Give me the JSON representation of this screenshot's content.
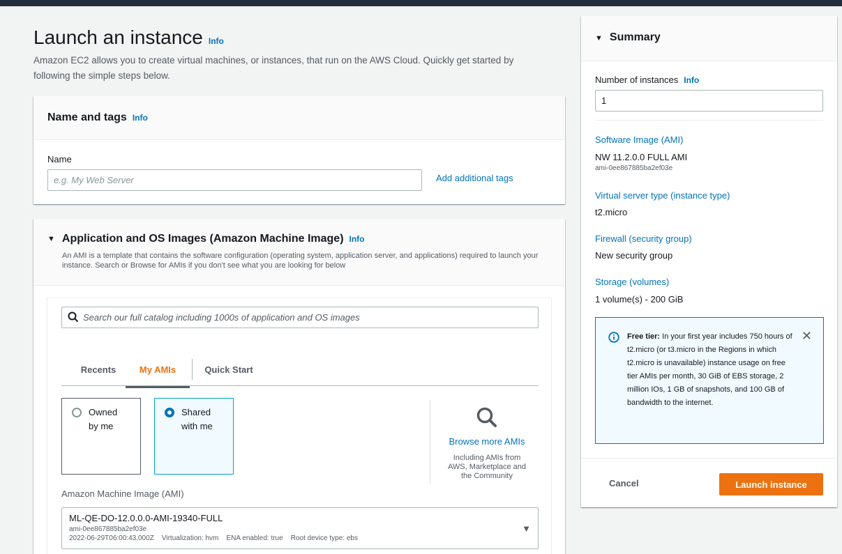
{
  "page": {
    "title": "Launch an instance",
    "info": "Info",
    "description": "Amazon EC2 allows you to create virtual machines, or instances, that run on the AWS Cloud. Quickly get started by following the simple steps below."
  },
  "name_tags": {
    "heading": "Name and tags",
    "info": "Info",
    "name_label": "Name",
    "name_placeholder": "e.g. My Web Server",
    "name_value": "",
    "add_tags_label": "Add additional tags"
  },
  "ami_section": {
    "heading": "Application and OS Images (Amazon Machine Image)",
    "info": "Info",
    "description": "An AMI is a template that contains the software configuration (operating system, application server, and applications) required to launch your instance. Search or Browse for AMIs if you don't see what you are looking for below",
    "search_placeholder": "Search our full catalog including 1000s of application and OS images",
    "tabs": [
      "Recents",
      "My AMIs",
      "Quick Start"
    ],
    "active_tab": "My AMIs",
    "owned_line1": "Owned",
    "owned_line2": "by me",
    "shared_line1": "Shared",
    "shared_line2": "with me",
    "selected_source": "Shared with me",
    "browse_label": "Browse more AMIs",
    "browse_sub_1": "Including AMIs from",
    "browse_sub_2": "AWS, Marketplace and",
    "browse_sub_3": "the Community",
    "ami_label": "Amazon Machine Image (AMI)",
    "selected_ami": {
      "name": "ML-QE-DO-12.0.0.0-AMI-19340-FULL",
      "id": "ami-0ee867885ba2ef03e",
      "meta": "2022-06-29T06:00:43.000Z    Virtualization: hvm    ENA enabled: true    Root device type: ebs"
    }
  },
  "summary": {
    "heading": "Summary",
    "instances_label": "Number of instances",
    "info": "Info",
    "instances_value": "1",
    "software_image_label": "Software Image (AMI)",
    "software_image_value": "NW 11.2.0.0 FULL AMI",
    "software_image_id": "ami-0ee867885ba2ef03e",
    "instance_type_label": "Virtual server type (instance type)",
    "instance_type_value": "t2.micro",
    "firewall_label": "Firewall (security group)",
    "firewall_value": "New security group",
    "storage_label": "Storage (volumes)",
    "storage_value": "1 volume(s) - 200 GiB",
    "free_tier_title": "Free tier:",
    "free_tier_text": "In your first year includes 750 hours of t2.micro (or t3.micro in the Regions in which t2.micro is unavailable) instance usage on free tier AMIs per month, 30 GiB of EBS storage, 2 million IOs, 1 GB of snapshots, and 100 GB of bandwidth to the internet.",
    "cancel_label": "Cancel",
    "launch_label": "Launch instance"
  },
  "colors": {
    "accent_orange": "#ec7211",
    "link_blue": "#0073bb",
    "selected_border": "#00a1c9",
    "topbar": "#232f3e"
  },
  "icons": [
    "search-icon",
    "magnifier-icon",
    "info-circle-icon",
    "close-icon",
    "caret-down-icon"
  ]
}
